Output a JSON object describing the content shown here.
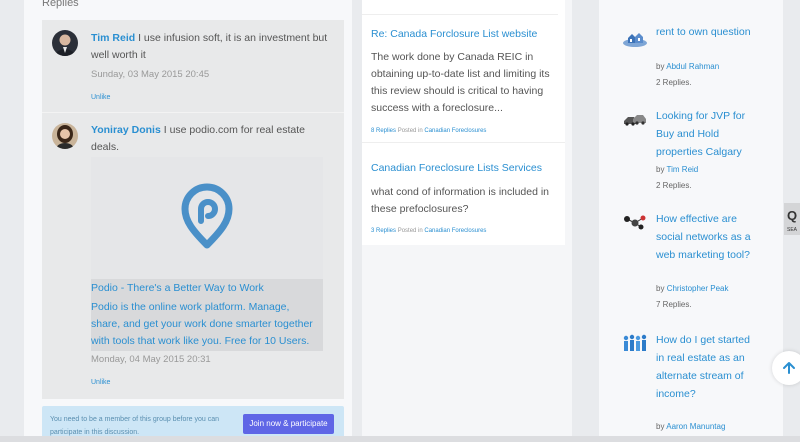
{
  "left": {
    "heading": "Replies",
    "replies": [
      {
        "author": "Tim Reid",
        "text": " I use infusion soft, it is an investment but well worth it",
        "date": "Sunday, 03 May 2015 20:45",
        "unlike": "Unlike"
      },
      {
        "author": "Yoniray Donis",
        "text": " I use podio.com for real estate deals.",
        "date": "Monday, 04 May 2015 20:31",
        "unlike": "Unlike"
      }
    ],
    "link_preview": {
      "title": "Podio - There's a Better Way to Work",
      "description": "Podio is the online work platform. Manage, share, and get your work done smarter together with tools that work like you. Free for 10 Users."
    },
    "join": {
      "notice": "You need to be a member of this group before you can participate in this discussion.",
      "button": "Join now & participate"
    }
  },
  "middle": {
    "topics": [
      {
        "title": "Re: Canada Forclosure List website",
        "excerpt": "The work done by Canada REIC in obtaining up-to-date list and limiting its this review should is critical to having success with a foreclosure...",
        "replies": "8 Replies",
        "posted_in": "Posted in",
        "category": "Canadian Foreclosures"
      },
      {
        "title": "Canadian Foreclosure Lists Services",
        "excerpt": "what cond of information is included in these prefoclosures?",
        "replies": "3 Replies",
        "posted_in": "Posted in",
        "category": "Canadian Foreclosures"
      }
    ]
  },
  "right": {
    "questions": [
      {
        "title": "rent to own question",
        "by": "by",
        "author": "Abdul Rahman",
        "replies": "2 Replies.",
        "thumb_icon": "houses-thumbnail-icon"
      },
      {
        "title": "Looking for JVP for Buy and Hold properties Calgary",
        "by": "by",
        "author": "Tim Reid",
        "replies": "2 Replies.",
        "thumb_icon": "cars-thumbnail-icon"
      },
      {
        "title": "How effective are social networks as a web marketing tool?",
        "by": "by",
        "author": "Christopher Peak",
        "replies": "7 Replies.",
        "thumb_icon": "network-thumbnail-icon"
      },
      {
        "title": "How do I get started in real estate as an alternate stream of income?",
        "by": "by",
        "author": "Aaron Manuntag",
        "replies": "",
        "thumb_icon": "people-thumbnail-icon"
      }
    ]
  },
  "widgets": {
    "search_tab_letter": "Q",
    "search_tab_label": "SEA",
    "back_to_top_icon": "arrow-up-icon"
  },
  "colors": {
    "link": "#2a8fd1",
    "join_button": "#5f66e6",
    "join_box": "#cde6f6",
    "podio_logo": "#4a90c8"
  }
}
